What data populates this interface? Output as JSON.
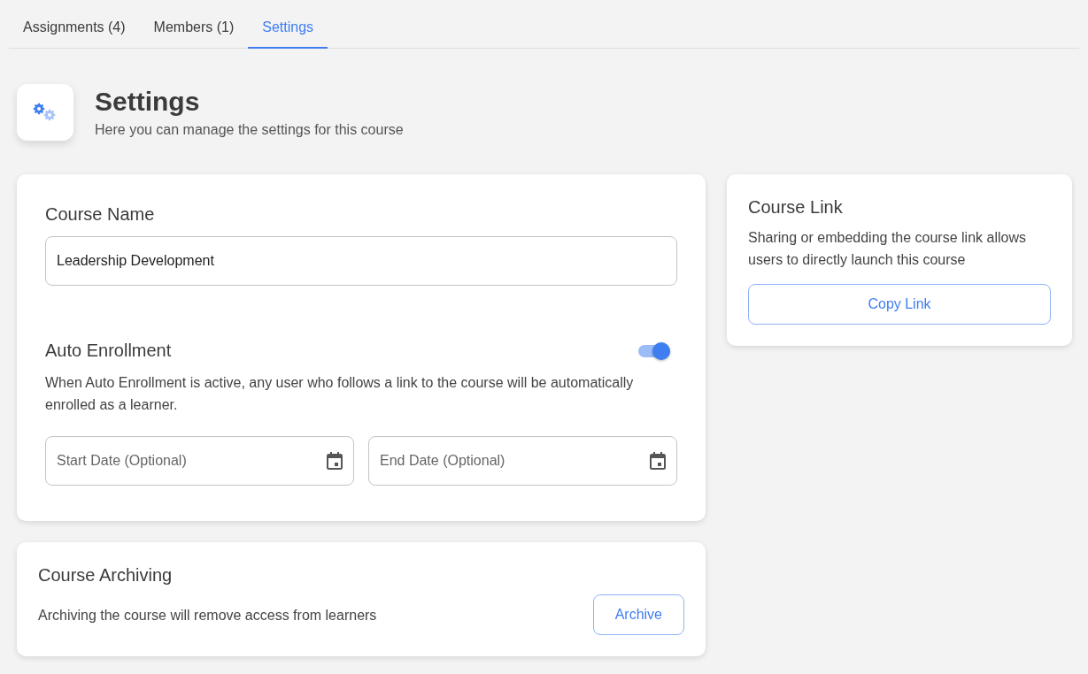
{
  "tabs": [
    {
      "label": "Assignments (4)",
      "selected": false
    },
    {
      "label": "Members (1)",
      "selected": false
    },
    {
      "label": "Settings",
      "selected": true
    }
  ],
  "header": {
    "title": "Settings",
    "subtitle": "Here you can manage the settings for this course"
  },
  "course_settings": {
    "name_label": "Course Name",
    "name_value": "Leadership Development",
    "auto_enrollment": {
      "title": "Auto Enrollment",
      "on": true,
      "description": "When Auto Enrollment is active, any user who follows a link to the course will be automatically enrolled as a learner."
    },
    "date_fields": [
      {
        "placeholder": "Start Date (Optional)"
      },
      {
        "placeholder": "End Date (Optional)"
      }
    ]
  },
  "archiving": {
    "title": "Course Archiving",
    "description": "Archiving the course will remove access from learners",
    "button": "Archive"
  },
  "course_link": {
    "title": "Course Link",
    "description": "Sharing or embedding the course link allows users to directly launch this course",
    "button": "Copy Link"
  }
}
